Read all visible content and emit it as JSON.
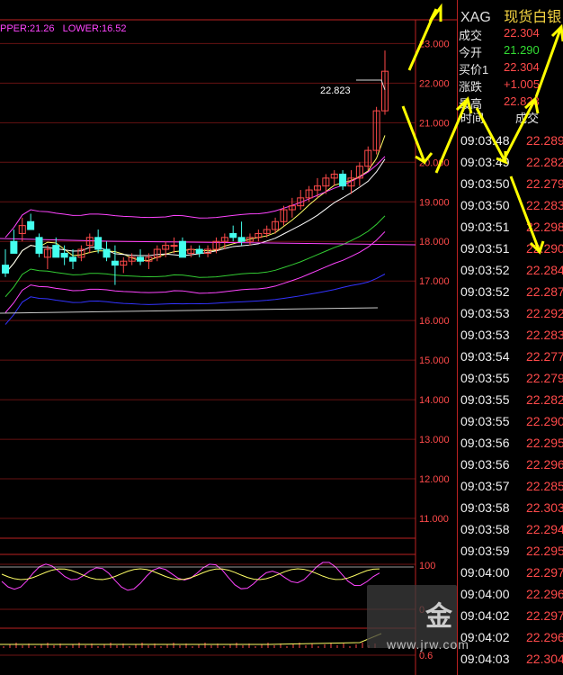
{
  "chart_top": {
    "upper_label": "PPER:21.26",
    "lower_label": "LOWER:16.52",
    "price_marker": "22.823"
  },
  "chart_data": {
    "type": "candlestick",
    "y_ticks": [
      "23.000",
      "22.000",
      "21.000",
      "20.000",
      "19.000",
      "18.000",
      "17.000",
      "16.000",
      "15.000",
      "14.000",
      "13.000",
      "12.000",
      "11.000"
    ],
    "ylim": [
      10.5,
      23.6
    ],
    "candles": [
      {
        "o": 17.4,
        "h": 17.8,
        "l": 17.1,
        "c": 17.2
      },
      {
        "o": 18.0,
        "h": 18.3,
        "l": 17.7,
        "c": 17.7
      },
      {
        "o": 18.2,
        "h": 18.6,
        "l": 18.0,
        "c": 18.4
      },
      {
        "o": 18.5,
        "h": 18.7,
        "l": 18.3,
        "c": 18.3
      },
      {
        "o": 18.1,
        "h": 18.2,
        "l": 17.6,
        "c": 17.7
      },
      {
        "o": 17.6,
        "h": 17.9,
        "l": 17.3,
        "c": 17.8
      },
      {
        "o": 17.9,
        "h": 18.1,
        "l": 17.6,
        "c": 17.6
      },
      {
        "o": 17.7,
        "h": 17.9,
        "l": 17.4,
        "c": 17.6
      },
      {
        "o": 17.6,
        "h": 17.8,
        "l": 17.3,
        "c": 17.5
      },
      {
        "o": 17.6,
        "h": 17.9,
        "l": 17.5,
        "c": 17.8
      },
      {
        "o": 17.9,
        "h": 18.2,
        "l": 17.7,
        "c": 18.1
      },
      {
        "o": 18.1,
        "h": 18.3,
        "l": 17.7,
        "c": 17.8
      },
      {
        "o": 17.8,
        "h": 18.0,
        "l": 17.5,
        "c": 17.6
      },
      {
        "o": 17.5,
        "h": 17.9,
        "l": 16.9,
        "c": 17.4
      },
      {
        "o": 17.4,
        "h": 17.6,
        "l": 17.2,
        "c": 17.5
      },
      {
        "o": 17.5,
        "h": 17.7,
        "l": 17.4,
        "c": 17.6
      },
      {
        "o": 17.6,
        "h": 17.8,
        "l": 17.4,
        "c": 17.5
      },
      {
        "o": 17.5,
        "h": 17.7,
        "l": 17.3,
        "c": 17.6
      },
      {
        "o": 17.6,
        "h": 17.9,
        "l": 17.5,
        "c": 17.8
      },
      {
        "o": 17.8,
        "h": 18.0,
        "l": 17.6,
        "c": 17.9
      },
      {
        "o": 17.9,
        "h": 18.1,
        "l": 17.7,
        "c": 17.9
      },
      {
        "o": 18.0,
        "h": 18.1,
        "l": 17.6,
        "c": 17.6
      },
      {
        "o": 17.7,
        "h": 17.9,
        "l": 17.6,
        "c": 17.8
      },
      {
        "o": 17.8,
        "h": 17.9,
        "l": 17.6,
        "c": 17.7
      },
      {
        "o": 17.7,
        "h": 17.9,
        "l": 17.6,
        "c": 17.8
      },
      {
        "o": 17.8,
        "h": 18.1,
        "l": 17.7,
        "c": 18.0
      },
      {
        "o": 18.0,
        "h": 18.2,
        "l": 17.8,
        "c": 18.1
      },
      {
        "o": 18.2,
        "h": 18.4,
        "l": 18.0,
        "c": 18.1
      },
      {
        "o": 18.1,
        "h": 18.5,
        "l": 17.9,
        "c": 18.0
      },
      {
        "o": 18.0,
        "h": 18.2,
        "l": 17.9,
        "c": 18.1
      },
      {
        "o": 18.1,
        "h": 18.3,
        "l": 18.0,
        "c": 18.2
      },
      {
        "o": 18.2,
        "h": 18.4,
        "l": 18.1,
        "c": 18.3
      },
      {
        "o": 18.3,
        "h": 18.6,
        "l": 18.2,
        "c": 18.5
      },
      {
        "o": 18.5,
        "h": 18.9,
        "l": 18.4,
        "c": 18.8
      },
      {
        "o": 18.8,
        "h": 19.1,
        "l": 18.6,
        "c": 18.9
      },
      {
        "o": 18.9,
        "h": 19.3,
        "l": 18.8,
        "c": 19.1
      },
      {
        "o": 19.1,
        "h": 19.4,
        "l": 19.0,
        "c": 19.3
      },
      {
        "o": 19.3,
        "h": 19.6,
        "l": 19.1,
        "c": 19.4
      },
      {
        "o": 19.4,
        "h": 19.7,
        "l": 19.2,
        "c": 19.6
      },
      {
        "o": 19.6,
        "h": 19.8,
        "l": 19.4,
        "c": 19.7
      },
      {
        "o": 19.7,
        "h": 19.8,
        "l": 19.3,
        "c": 19.4
      },
      {
        "o": 19.4,
        "h": 19.8,
        "l": 19.2,
        "c": 19.6
      },
      {
        "o": 19.6,
        "h": 20.0,
        "l": 19.4,
        "c": 19.9
      },
      {
        "o": 19.9,
        "h": 20.4,
        "l": 19.8,
        "c": 20.3
      },
      {
        "o": 20.3,
        "h": 21.4,
        "l": 20.2,
        "c": 21.3
      },
      {
        "o": 21.3,
        "h": 22.823,
        "l": 21.2,
        "c": 22.3
      }
    ],
    "series_colors": [
      "#ffff66",
      "#ffffff",
      "#3333ff",
      "#33cc33",
      "#ff44ff",
      "#cccccc"
    ]
  },
  "indicator1": {
    "label_top": "100",
    "label_bottom": "0"
  },
  "indicator2": {
    "label": "0.6"
  },
  "quote_panel": {
    "symbol": "XAG",
    "name": "现货白银",
    "rows": [
      {
        "label": "成交",
        "value": "22.304",
        "color": "#ff4a4a"
      },
      {
        "label": "今开",
        "value": "21.290",
        "color": "#33dd33"
      },
      {
        "label": "买价1",
        "value": "22.304",
        "color": "#ff4a4a"
      },
      {
        "label": "涨跌",
        "value": "+1.005",
        "color": "#ff4a4a"
      },
      {
        "label": "最高",
        "value": "22.823",
        "color": "#ff4a4a"
      }
    ],
    "tick_header_time": "时间",
    "tick_header_price": "成交",
    "ticks": [
      {
        "time": "09:03:48",
        "price": "22.289"
      },
      {
        "time": "09:03:49",
        "price": "22.282"
      },
      {
        "time": "09:03:50",
        "price": "22.279"
      },
      {
        "time": "09:03:50",
        "price": "22.283"
      },
      {
        "time": "09:03:51",
        "price": "22.298"
      },
      {
        "time": "09:03:51",
        "price": "22.290"
      },
      {
        "time": "09:03:52",
        "price": "22.284"
      },
      {
        "time": "09:03:52",
        "price": "22.287"
      },
      {
        "time": "09:03:53",
        "price": "22.292"
      },
      {
        "time": "09:03:53",
        "price": "22.283"
      },
      {
        "time": "09:03:54",
        "price": "22.277"
      },
      {
        "time": "09:03:55",
        "price": "22.279"
      },
      {
        "time": "09:03:55",
        "price": "22.282"
      },
      {
        "time": "09:03:55",
        "price": "22.290"
      },
      {
        "time": "09:03:56",
        "price": "22.295"
      },
      {
        "time": "09:03:56",
        "price": "22.296"
      },
      {
        "time": "09:03:57",
        "price": "22.285"
      },
      {
        "time": "09:03:58",
        "price": "22.303"
      },
      {
        "time": "09:03:58",
        "price": "22.294"
      },
      {
        "time": "09:03:59",
        "price": "22.295"
      },
      {
        "time": "09:04:00",
        "price": "22.297"
      },
      {
        "time": "09:04:00",
        "price": "22.296"
      },
      {
        "time": "09:04:02",
        "price": "22.297"
      },
      {
        "time": "09:04:02",
        "price": "22.296"
      },
      {
        "time": "09:04:03",
        "price": "22.304"
      }
    ]
  },
  "watermark": {
    "logo": "金",
    "url": "www.jrw.com"
  }
}
